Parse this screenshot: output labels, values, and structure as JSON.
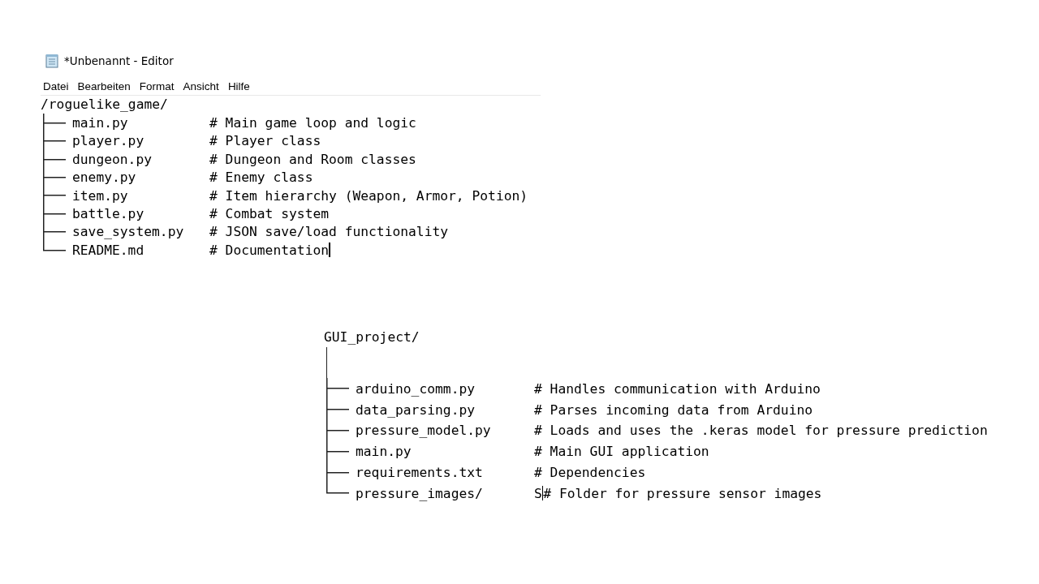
{
  "editor": {
    "title": "*Unbenannt - Editor",
    "menu": [
      "Datei",
      "Bearbeiten",
      "Format",
      "Ansicht",
      "Hilfe"
    ],
    "tree": {
      "root": "/roguelike_game/",
      "rows": [
        {
          "name": "main.py",
          "comment": "# Main game loop and logic",
          "cursor": false
        },
        {
          "name": "player.py",
          "comment": "# Player class",
          "cursor": false
        },
        {
          "name": "dungeon.py",
          "comment": "# Dungeon and Room classes",
          "cursor": false
        },
        {
          "name": "enemy.py",
          "comment": "# Enemy class",
          "cursor": false
        },
        {
          "name": "item.py",
          "comment": "# Item hierarchy (Weapon, Armor, Potion)",
          "cursor": false
        },
        {
          "name": "battle.py",
          "comment": "# Combat system",
          "cursor": false
        },
        {
          "name": "save_system.py",
          "comment": "# JSON save/load functionality",
          "cursor": false
        },
        {
          "name": "README.md",
          "comment": "# Documentation",
          "cursor": true
        }
      ]
    }
  },
  "listing": {
    "tree": {
      "root": "GUI_project/",
      "rows": [
        {
          "name": "arduino_comm.py",
          "comment": "# Handles communication with Arduino",
          "cursor": false
        },
        {
          "name": "data_parsing.py",
          "comment": "# Parses incoming data from Arduino",
          "cursor": false
        },
        {
          "name": "pressure_model.py",
          "comment": "# Loads and uses the .keras model for pressure prediction",
          "cursor": false
        },
        {
          "name": "main.py",
          "comment": "# Main GUI application",
          "cursor": false
        },
        {
          "name": "requirements.txt",
          "comment": "# Dependencies",
          "cursor": false
        },
        {
          "name": "pressure_images/",
          "prefix": "S",
          "comment": "# Folder for pressure sensor images",
          "cursor": true
        }
      ]
    }
  }
}
